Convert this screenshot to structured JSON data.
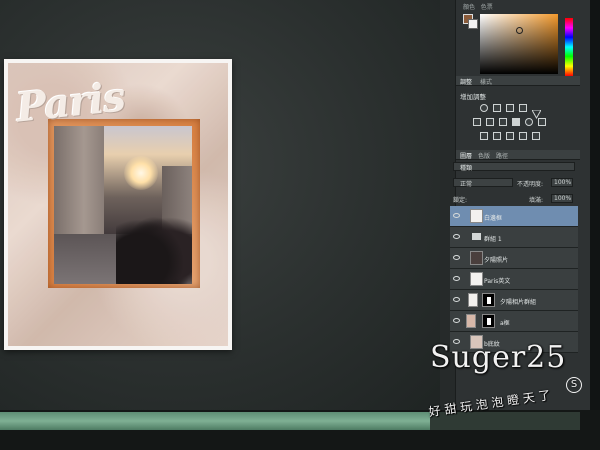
{
  "colors": {
    "accent_selected_layer": "#6f8db0",
    "foreground_swatch": "#8a5b3a",
    "background_swatch": "#f2f2f2"
  },
  "color_panel": {
    "tabs": [
      "顏色",
      "色票"
    ]
  },
  "adjustments_panel": {
    "tabs": [
      "調整",
      "樣式"
    ],
    "title": "增加調整",
    "icons": [
      "brightness-icon",
      "levels-icon",
      "curves-icon",
      "exposure-icon",
      "triangle-icon",
      "vibrance-icon",
      "hue-icon",
      "color-balance-icon",
      "bw-icon",
      "photo-filter-icon",
      "channel-mixer-icon",
      "invert-icon",
      "posterize-icon",
      "threshold-icon",
      "gradient-map-icon",
      "selective-color-icon"
    ]
  },
  "layers_panel": {
    "tabs": [
      "圖層",
      "色版",
      "路徑"
    ],
    "filter": "種類",
    "blend_mode": "正常",
    "opacity_label": "不透明度:",
    "opacity_value": "100%",
    "lock_label": "鎖定:",
    "fill_label": "填滿:",
    "fill_value": "100%",
    "layers": [
      {
        "name": "白邊框",
        "kind": "layer",
        "selected": true
      },
      {
        "name": "群組 1",
        "kind": "group",
        "selected": false
      },
      {
        "name": "夕陽照片",
        "kind": "layer",
        "selected": false
      },
      {
        "name": "Paris英文",
        "kind": "layer",
        "selected": false
      },
      {
        "name": "夕陽相片群組",
        "kind": "masked",
        "selected": false
      },
      {
        "name": "a框",
        "kind": "masked",
        "selected": false
      },
      {
        "name": "b底紋",
        "kind": "layer",
        "selected": false
      }
    ]
  },
  "document": {
    "overlay_text": "Paris"
  },
  "watermark": {
    "main": "Suger25",
    "mark": "S",
    "sub": "好 甜 玩 泡 泡 瞪 天 了"
  }
}
